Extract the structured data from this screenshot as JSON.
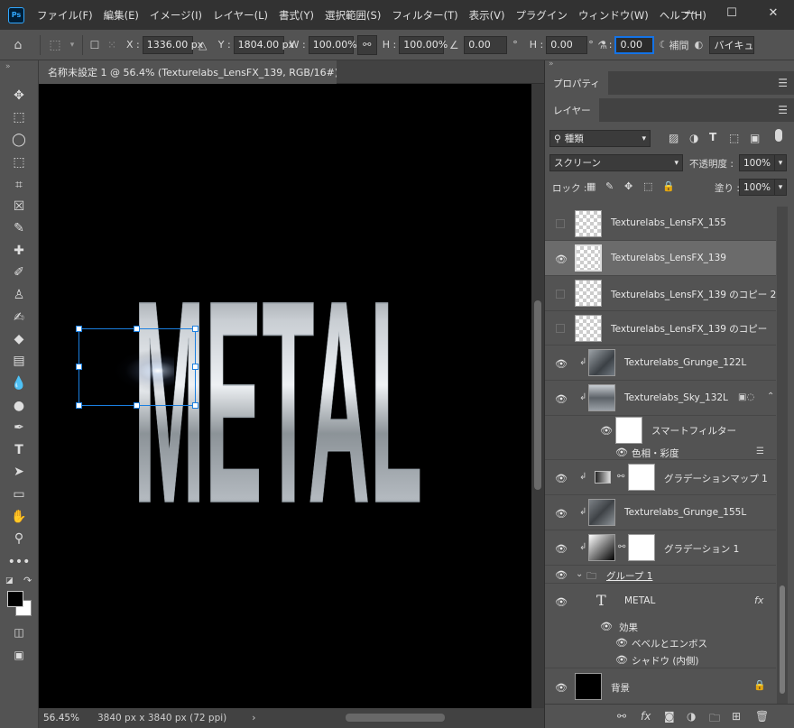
{
  "app": {
    "logo": "Ps"
  },
  "menu": [
    "ファイル(F)",
    "編集(E)",
    "イメージ(I)",
    "レイヤー(L)",
    "書式(Y)",
    "選択範囲(S)",
    "フィルター(T)",
    "表示(V)",
    "プラグイン",
    "ウィンドウ(W)",
    "ヘルプ(H)"
  ],
  "window_controls": {
    "minimize": "—",
    "maximize": "☐",
    "close": "✕"
  },
  "options": {
    "x_label": "X :",
    "x_value": "1336.00 px",
    "y_label": "Y :",
    "y_value": "1804.00 px",
    "w_label": "W :",
    "w_value": "100.00%",
    "h_label": "H :",
    "h_value": "100.00%",
    "angle_value": "0.00",
    "angle_unit": "°",
    "hskew_label": "H :",
    "hskew_value": "0.00",
    "hskew_unit": "°",
    "vskew_label": ":",
    "vskew_value": "0.00",
    "interp_label": "補間",
    "interp_value": "バイキュ"
  },
  "document": {
    "tab_title": "名称未設定 1 @ 56.4% (Texturelabs_LensFX_139, RGB/16#) *",
    "close": "×"
  },
  "status": {
    "zoom": "56.45%",
    "doc_size": "3840 px x 3840 px (72 ppi)",
    "arrow": "›"
  },
  "canvas_text": "METAL",
  "properties_panel": {
    "tab": "プロパティ"
  },
  "layers_panel": {
    "tab": "レイヤー",
    "filter_kind": "種類",
    "blend_mode": "スクリーン",
    "opacity_label": "不透明度 :",
    "opacity_value": "100%",
    "lock_label": "ロック :",
    "fill_label": "塗り :",
    "fill_value": "100%"
  },
  "layers": [
    {
      "name": "Texturelabs_LensFX_155",
      "visible": false
    },
    {
      "name": "Texturelabs_LensFX_139",
      "visible": true,
      "selected": true
    },
    {
      "name": "Texturelabs_LensFX_139 のコピー 2",
      "visible": false
    },
    {
      "name": "Texturelabs_LensFX_139 のコピー",
      "visible": false
    },
    {
      "name": "Texturelabs_Grunge_122L",
      "visible": true,
      "clipped": true
    },
    {
      "name": "Texturelabs_Sky_132L",
      "visible": true,
      "clipped": true
    },
    {
      "name": "スマートフィルター",
      "visible": true
    },
    {
      "name": "色相・彩度",
      "visible": true
    },
    {
      "name": "グラデーションマップ 1",
      "visible": true,
      "clipped": true
    },
    {
      "name": "Texturelabs_Grunge_155L",
      "visible": true,
      "clipped": true
    },
    {
      "name": "グラデーション 1",
      "visible": true,
      "clipped": true
    },
    {
      "name": "グループ 1",
      "visible": true
    },
    {
      "name": "METAL",
      "visible": true,
      "fx": "fx"
    },
    {
      "name": "効果",
      "visible": true
    },
    {
      "name": "ベベルとエンボス",
      "visible": true
    },
    {
      "name": "シャドウ (内側)",
      "visible": true
    },
    {
      "name": "背景",
      "visible": true,
      "locked": true
    }
  ]
}
